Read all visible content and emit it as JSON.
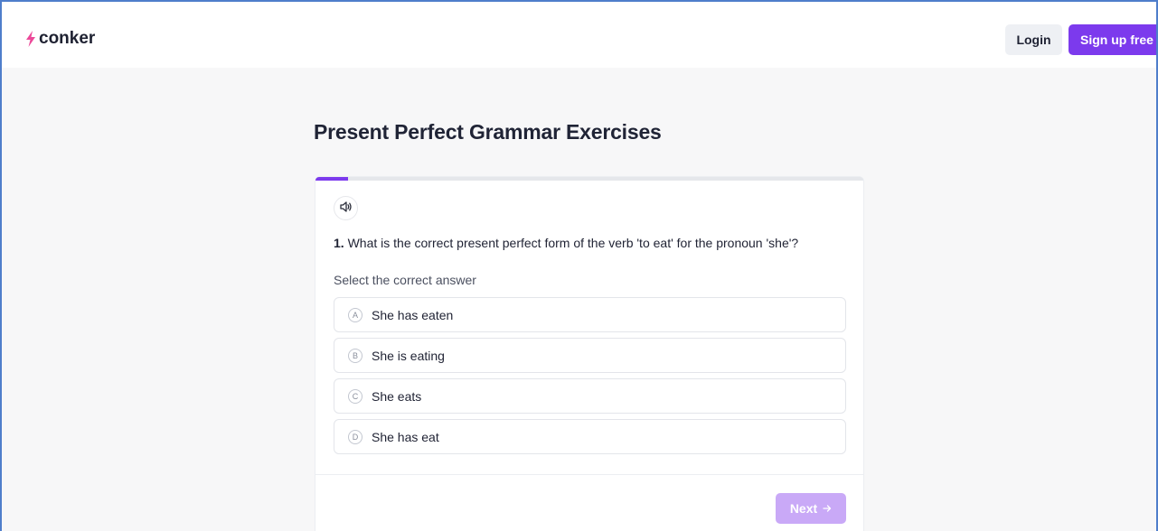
{
  "header": {
    "brand": "conker",
    "login_label": "Login",
    "signup_label": "Sign up free"
  },
  "colors": {
    "accent": "#7c3aed",
    "logo_bolt": "#ec4899",
    "next_disabled": "#c9a9f7"
  },
  "quiz": {
    "title": "Present Perfect Grammar Exercises",
    "progress": 0.06,
    "question_number": "1.",
    "question_text": "What is the correct present perfect form of the verb 'to eat' for the pronoun 'she'?",
    "hint": "Select the correct answer",
    "options": [
      {
        "letter": "A",
        "text": "She has eaten"
      },
      {
        "letter": "B",
        "text": "She is eating"
      },
      {
        "letter": "C",
        "text": "She eats"
      },
      {
        "letter": "D",
        "text": "She has eat"
      }
    ],
    "next_label": "Next",
    "next_icon": "arrow-right-icon",
    "audio_icon": "speaker-icon"
  }
}
